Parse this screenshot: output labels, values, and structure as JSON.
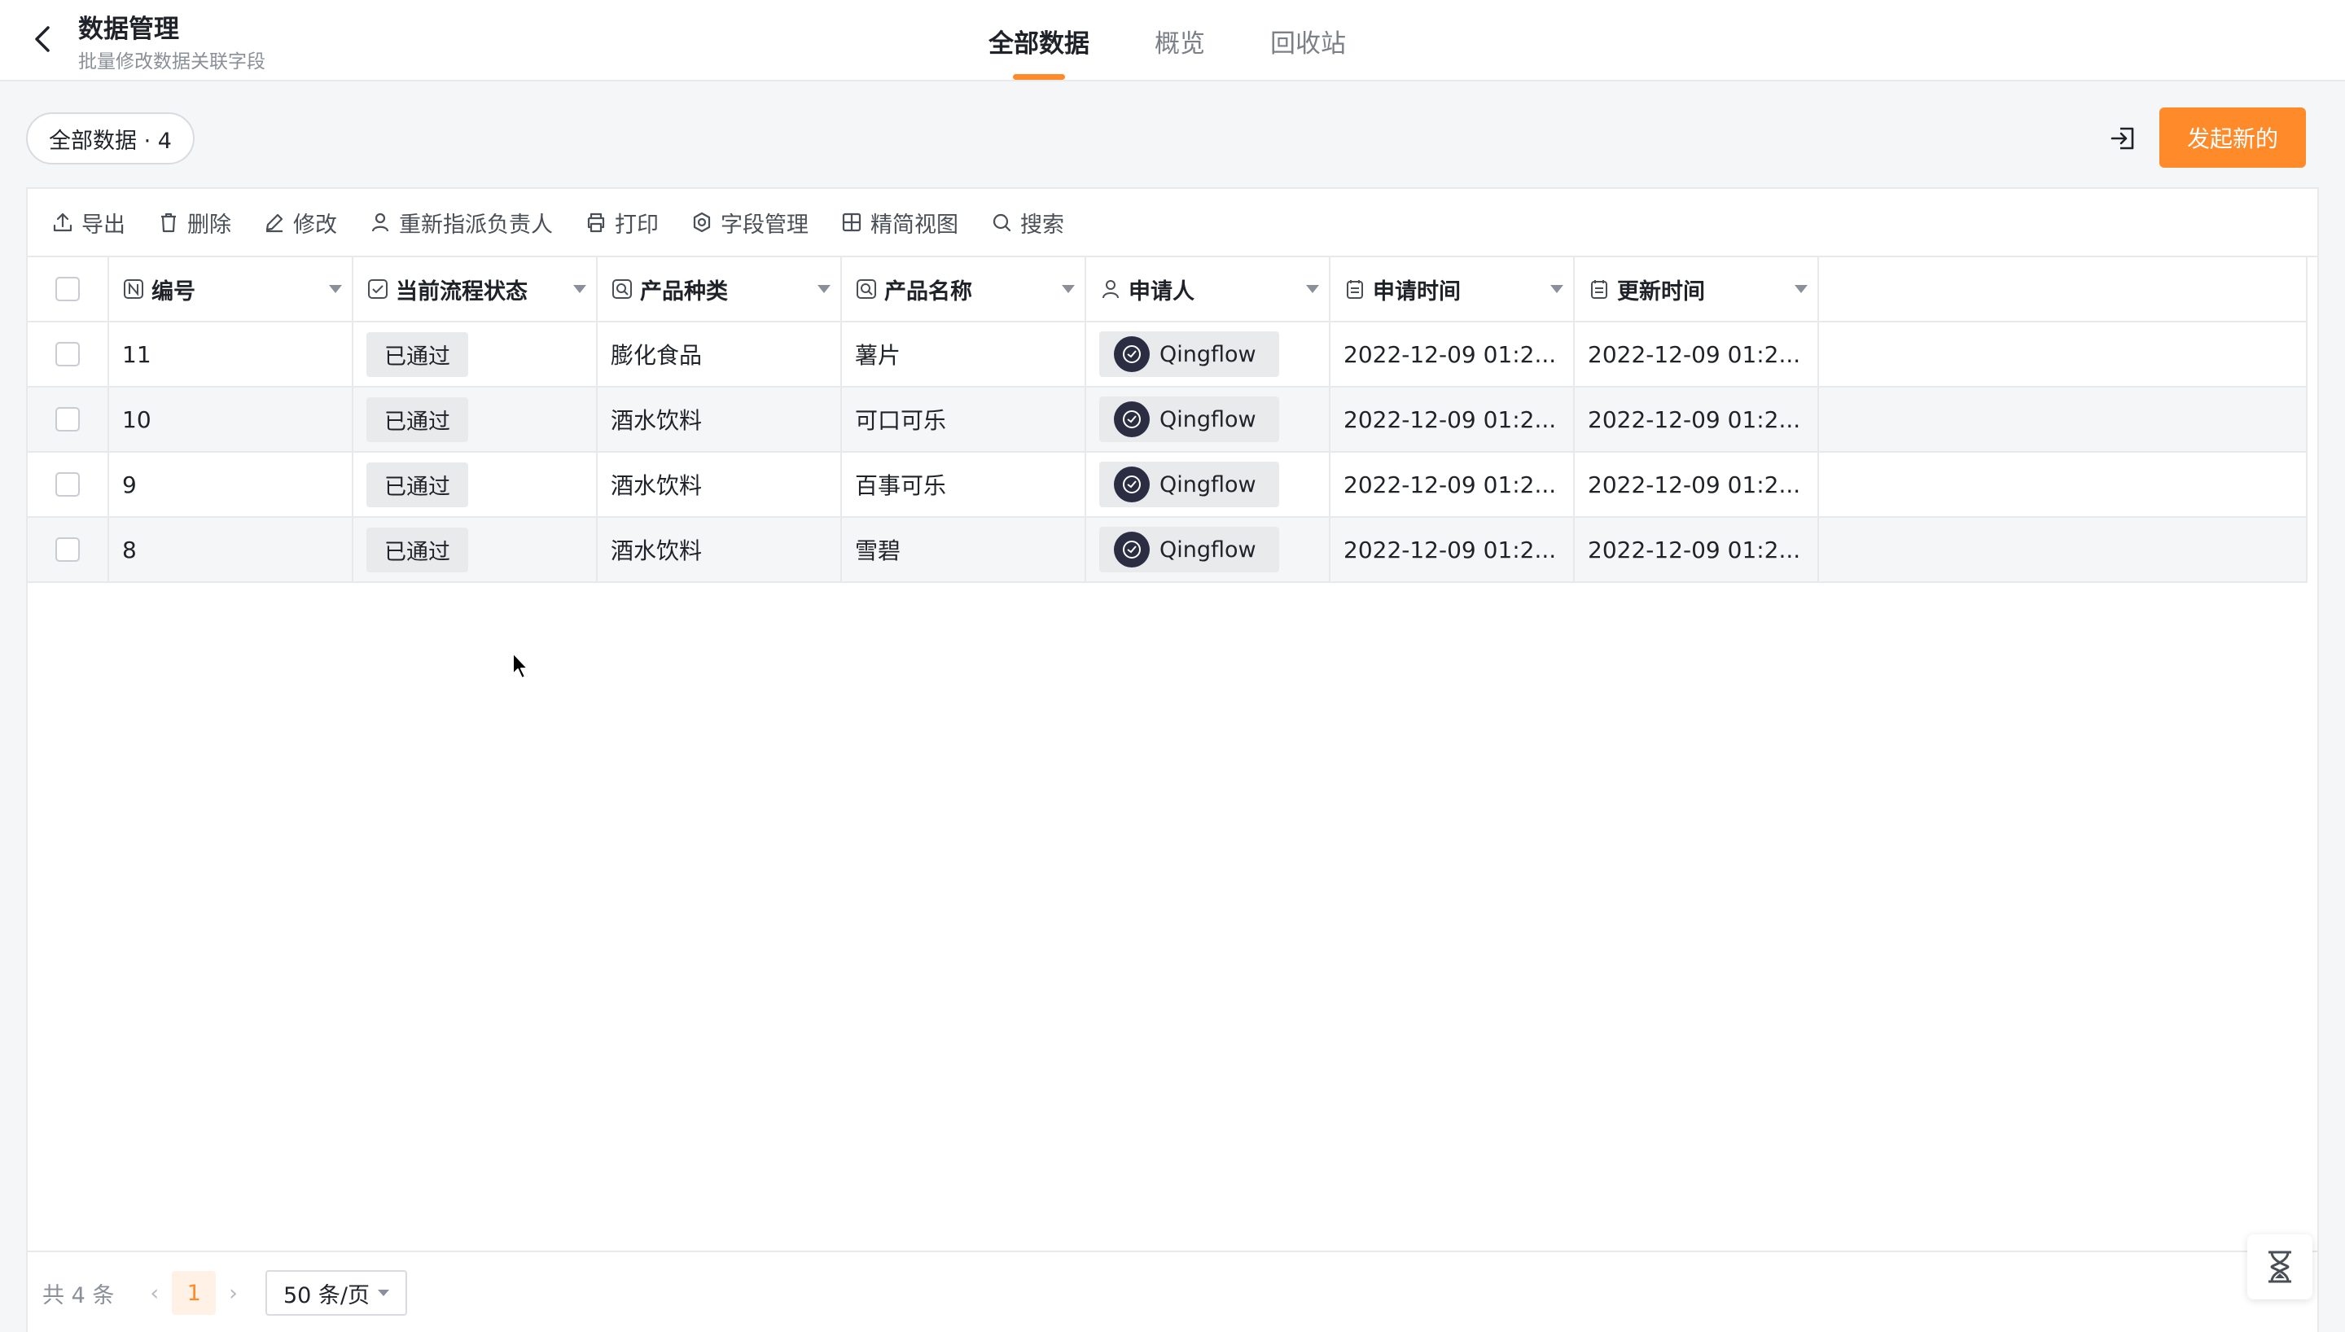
{
  "header": {
    "title": "数据管理",
    "subtitle": "批量修改数据关联字段",
    "tabs": [
      {
        "label": "全部数据",
        "active": true
      },
      {
        "label": "概览",
        "active": false
      },
      {
        "label": "回收站",
        "active": false
      }
    ]
  },
  "subbar": {
    "view_label": "全部数据 · 4",
    "new_button": "发起新的"
  },
  "toolbar": {
    "items": [
      {
        "label": "导出",
        "icon": "upload-icon"
      },
      {
        "label": "删除",
        "icon": "trash-icon"
      },
      {
        "label": "修改",
        "icon": "pencil-icon"
      },
      {
        "label": "重新指派负责人",
        "icon": "user-icon"
      },
      {
        "label": "打印",
        "icon": "printer-icon"
      },
      {
        "label": "字段管理",
        "icon": "gear-icon"
      },
      {
        "label": "精简视图",
        "icon": "grid-icon"
      },
      {
        "label": "搜索",
        "icon": "search-icon"
      }
    ]
  },
  "table": {
    "columns": [
      {
        "label": "编号",
        "icon": "number-icon"
      },
      {
        "label": "当前流程状态",
        "icon": "checkbox-icon"
      },
      {
        "label": "产品种类",
        "icon": "relation-icon"
      },
      {
        "label": "产品名称",
        "icon": "relation-icon"
      },
      {
        "label": "申请人",
        "icon": "user-icon"
      },
      {
        "label": "申请时间",
        "icon": "calendar-icon"
      },
      {
        "label": "更新时间",
        "icon": "calendar-icon"
      }
    ],
    "rows": [
      {
        "id": "11",
        "status": "已通过",
        "type": "膨化食品",
        "name": "薯片",
        "user": "Qingflow",
        "apply": "2022-12-09 01:2...",
        "update": "2022-12-09 01:2..."
      },
      {
        "id": "10",
        "status": "已通过",
        "type": "酒水饮料",
        "name": "可口可乐",
        "user": "Qingflow",
        "apply": "2022-12-09 01:2...",
        "update": "2022-12-09 01:2..."
      },
      {
        "id": "9",
        "status": "已通过",
        "type": "酒水饮料",
        "name": "百事可乐",
        "user": "Qingflow",
        "apply": "2022-12-09 01:2...",
        "update": "2022-12-09 01:2..."
      },
      {
        "id": "8",
        "status": "已通过",
        "type": "酒水饮料",
        "name": "雪碧",
        "user": "Qingflow",
        "apply": "2022-12-09 01:2...",
        "update": "2022-12-09 01:2..."
      }
    ]
  },
  "footer": {
    "total": "共 4 条",
    "prev": "‹",
    "page": "1",
    "next": "›",
    "page_size": "50 条/页"
  },
  "colors": {
    "accent": "#ff8a2a",
    "tag_bg": "#e9eaec",
    "avatar_bg": "#2b2d42"
  }
}
